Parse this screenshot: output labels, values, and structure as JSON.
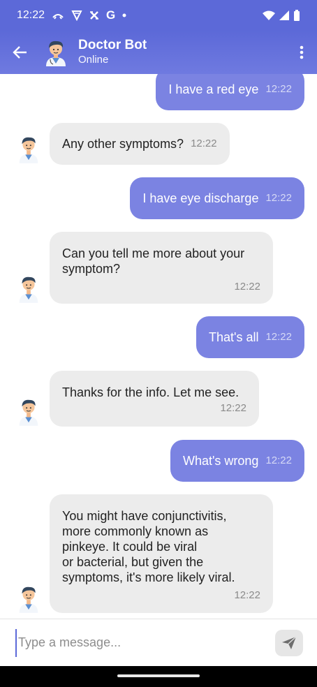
{
  "status_bar": {
    "time": "12:22",
    "left_icons": [
      "call-forward-icon",
      "vpn-shield-icon",
      "cross-icon",
      "google-g-icon",
      "dot-icon"
    ],
    "right_icons": [
      "wifi-icon",
      "signal-icon",
      "battery-icon"
    ]
  },
  "header": {
    "title": "Doctor Bot",
    "status": "Online"
  },
  "colors": {
    "header": "#5c69d8",
    "outgoing_bubble": "#7b83e2",
    "incoming_bubble": "#ececec"
  },
  "messages": [
    {
      "from": "user",
      "text": "I have a red eye",
      "time": "12:22"
    },
    {
      "from": "bot",
      "text": "Any other symptoms?",
      "time": "12:22"
    },
    {
      "from": "user",
      "text": "I have eye discharge",
      "time": "12:22"
    },
    {
      "from": "bot",
      "text": "Can you tell me more about your\nsymptom?",
      "time": "12:22"
    },
    {
      "from": "user",
      "text": "That's all",
      "time": "12:22"
    },
    {
      "from": "bot",
      "text": "Thanks for the info. Let me see.",
      "time": "12:22"
    },
    {
      "from": "user",
      "text": "What's wrong",
      "time": "12:22"
    },
    {
      "from": "bot",
      "text": "You might have conjunctivitis,\nmore commonly known as\npinkeye. It could be viral\nor bacterial, but given the\nsymptoms, it's more likely viral.",
      "time": "12:22"
    }
  ],
  "composer": {
    "placeholder": "Type a message..."
  }
}
